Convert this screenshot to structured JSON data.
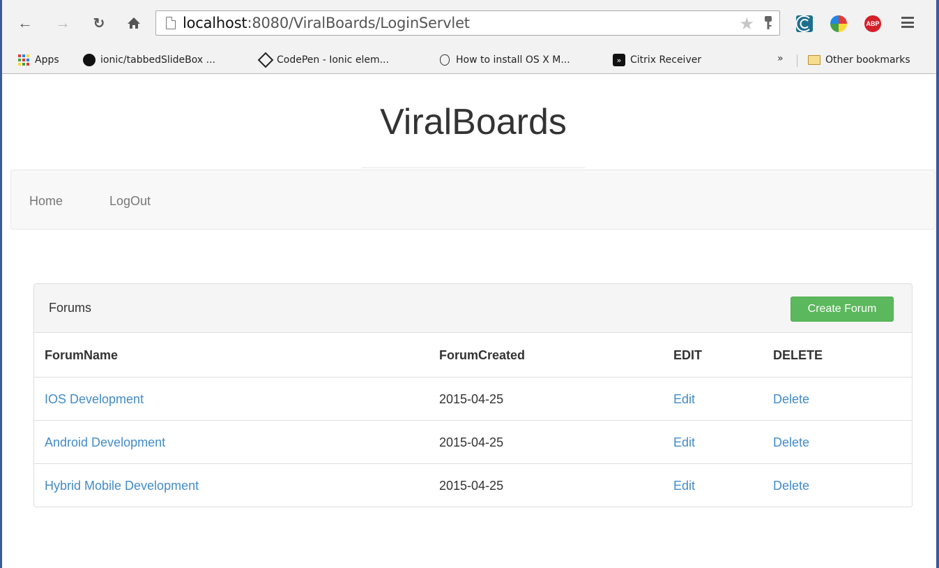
{
  "browser": {
    "url_host": "localhost",
    "url_path": ":8080/ViralBoards/LoginServlet",
    "bookmarks": [
      {
        "label": "Apps",
        "icon": "apps-grid-icon"
      },
      {
        "label": "ionic/tabbedSlideBox ...",
        "icon": "github-icon"
      },
      {
        "label": "CodePen - Ionic elem...",
        "icon": "codepen-icon"
      },
      {
        "label": "How to install OS X M...",
        "icon": "apple-icon"
      },
      {
        "label": "Citrix Receiver",
        "icon": "citrix-icon"
      }
    ],
    "bookmarks_overflow": "»",
    "other_bookmarks": "Other bookmarks",
    "abp_label": "ABP"
  },
  "site": {
    "title": "ViralBoards"
  },
  "navbar": {
    "items": [
      "Home",
      "LogOut"
    ]
  },
  "panel": {
    "title": "Forums",
    "create_button": "Create Forum",
    "columns": [
      "ForumName",
      "ForumCreated",
      "EDIT",
      "DELETE"
    ],
    "rows": [
      {
        "name": "IOS Development",
        "created": "2015-04-25",
        "edit": "Edit",
        "delete": "Delete"
      },
      {
        "name": "Android Development",
        "created": "2015-04-25",
        "edit": "Edit",
        "delete": "Delete"
      },
      {
        "name": "Hybrid Mobile Development",
        "created": "2015-04-25",
        "edit": "Edit",
        "delete": "Delete"
      }
    ]
  },
  "colors": {
    "link": "#428bca",
    "success": "#5cb85c",
    "navbar_bg": "#f8f8f8",
    "panel_heading_bg": "#f5f5f5"
  }
}
